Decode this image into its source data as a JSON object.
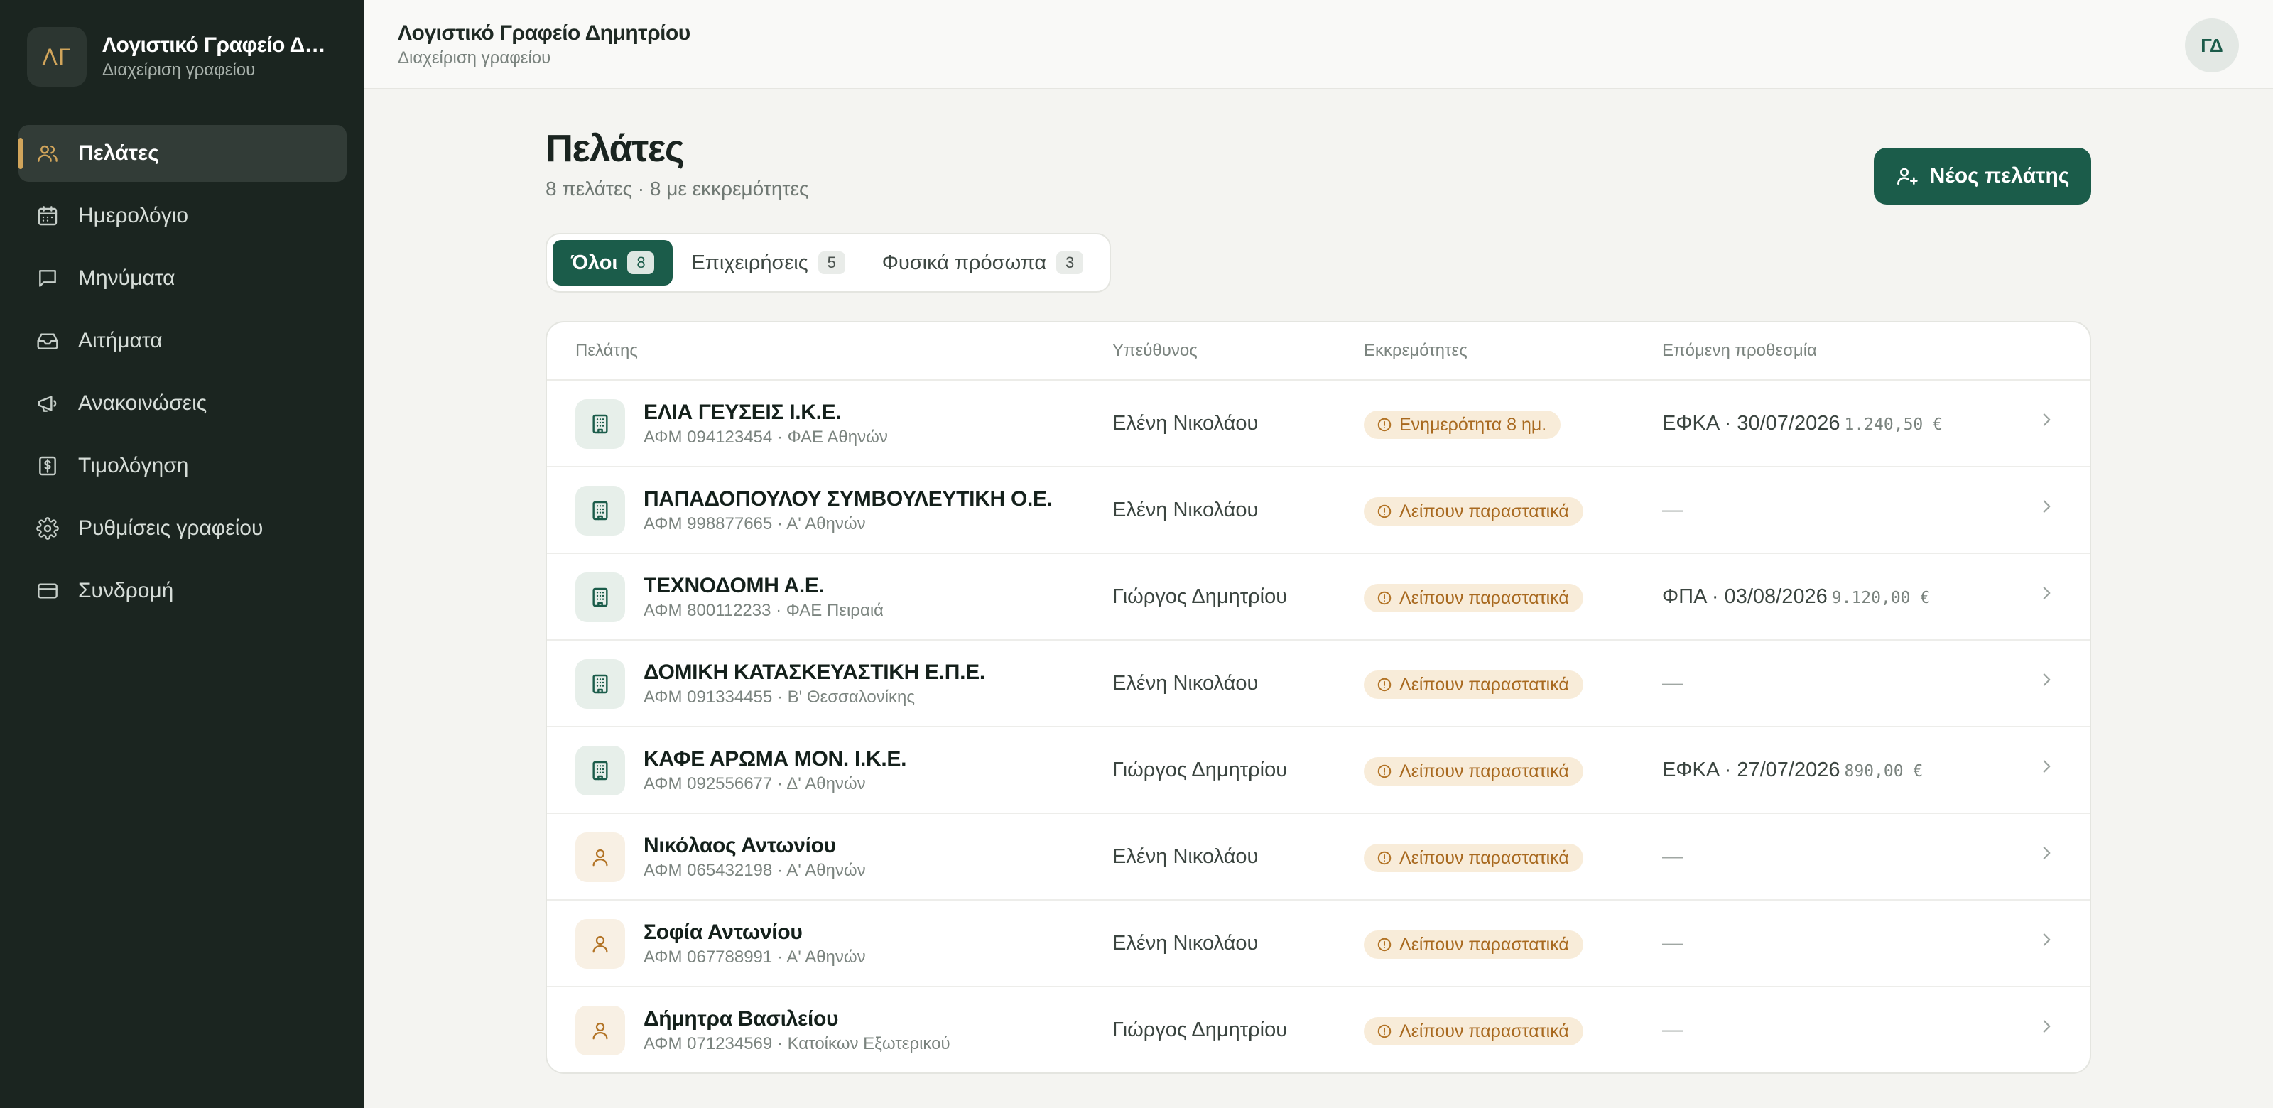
{
  "brand": {
    "logo_text": "ΛΓ",
    "name": "Λογιστικό Γραφείο Δημ...",
    "subtitle": "Διαχείριση γραφείου"
  },
  "nav": {
    "items": [
      {
        "label": "Πελάτες",
        "icon": "users-icon",
        "active": true
      },
      {
        "label": "Ημερολόγιο",
        "icon": "calendar-icon"
      },
      {
        "label": "Μηνύματα",
        "icon": "message-icon"
      },
      {
        "label": "Αιτήματα",
        "icon": "inbox-icon"
      },
      {
        "label": "Ανακοινώσεις",
        "icon": "megaphone-icon"
      },
      {
        "label": "Τιμολόγηση",
        "icon": "dollar-icon"
      },
      {
        "label": "Ρυθμίσεις γραφείου",
        "icon": "gear-icon"
      },
      {
        "label": "Συνδρομή",
        "icon": "credit-card-icon"
      }
    ]
  },
  "header": {
    "title": "Λογιστικό Γραφείο Δημητρίου",
    "subtitle": "Διαχείριση γραφείου",
    "avatar_initials": "ΓΔ"
  },
  "page": {
    "title": "Πελάτες",
    "subtitle": "8 πελάτες · 8 με εκκρεμότητες",
    "new_client_label": "Νέος πελάτης"
  },
  "tabs": [
    {
      "label": "Όλοι",
      "count": "8",
      "active": true
    },
    {
      "label": "Επιχειρήσεις",
      "count": "5"
    },
    {
      "label": "Φυσικά πρόσωπα",
      "count": "3"
    }
  ],
  "table": {
    "columns": {
      "client": "Πελάτης",
      "owner": "Υπεύθυνος",
      "pending": "Εκκρεμότητες",
      "deadline": "Επόμενη προθεσμία"
    },
    "rows": [
      {
        "type": "business",
        "name": "ΕΛΙΑ ΓΕΥΣΕΙΣ Ι.Κ.Ε.",
        "meta": "ΑΦΜ 094123454 · ΦΑΕ Αθηνών",
        "owner": "Ελένη Νικολάου",
        "badge": "Ενημερότητα 8 ημ.",
        "deadline": "ΕΦΚΑ · 30/07/2026",
        "amount": "1.240,50 €"
      },
      {
        "type": "business",
        "name": "ΠΑΠΑΔΟΠΟΥΛΟΥ ΣΥΜΒΟΥΛΕΥΤΙΚΗ Ο.Ε.",
        "meta": "ΑΦΜ 998877665 · Α' Αθηνών",
        "owner": "Ελένη Νικολάου",
        "badge": "Λείπουν παραστατικά",
        "deadline": "—",
        "amount": ""
      },
      {
        "type": "business",
        "name": "ΤΕΧΝΟΔΟΜΗ Α.Ε.",
        "meta": "ΑΦΜ 800112233 · ΦΑΕ Πειραιά",
        "owner": "Γιώργος Δημητρίου",
        "badge": "Λείπουν παραστατικά",
        "deadline": "ΦΠΑ · 03/08/2026",
        "amount": "9.120,00 €"
      },
      {
        "type": "business",
        "name": "ΔΟΜΙΚΗ ΚΑΤΑΣΚΕΥΑΣΤΙΚΗ Ε.Π.Ε.",
        "meta": "ΑΦΜ 091334455 · Β' Θεσσαλονίκης",
        "owner": "Ελένη Νικολάου",
        "badge": "Λείπουν παραστατικά",
        "deadline": "—",
        "amount": ""
      },
      {
        "type": "business",
        "name": "ΚΑΦΕ ΑΡΩΜΑ ΜΟΝ. Ι.Κ.Ε.",
        "meta": "ΑΦΜ 092556677 · Δ' Αθηνών",
        "owner": "Γιώργος Δημητρίου",
        "badge": "Λείπουν παραστατικά",
        "deadline": "ΕΦΚΑ · 27/07/2026",
        "amount": "890,00 €"
      },
      {
        "type": "person",
        "name": "Νικόλαος Αντωνίου",
        "meta": "ΑΦΜ 065432198 · Α' Αθηνών",
        "owner": "Ελένη Νικολάου",
        "badge": "Λείπουν παραστατικά",
        "deadline": "—",
        "amount": ""
      },
      {
        "type": "person",
        "name": "Σοφία Αντωνίου",
        "meta": "ΑΦΜ 067788991 · Α' Αθηνών",
        "owner": "Ελένη Νικολάου",
        "badge": "Λείπουν παραστατικά",
        "deadline": "—",
        "amount": ""
      },
      {
        "type": "person",
        "name": "Δήμητρα Βασιλείου",
        "meta": "ΑΦΜ 071234569 · Κατοίκων Εξωτερικού",
        "owner": "Γιώργος Δημητρίου",
        "badge": "Λείπουν παραστατικά",
        "deadline": "—",
        "amount": ""
      }
    ]
  },
  "colors": {
    "sidebar_bg": "#1b2520",
    "accent_green": "#1b5c4a",
    "accent_gold": "#d1a55b",
    "warning_badge_bg": "#f8ecd9",
    "warning_badge_text": "#a8691f"
  }
}
